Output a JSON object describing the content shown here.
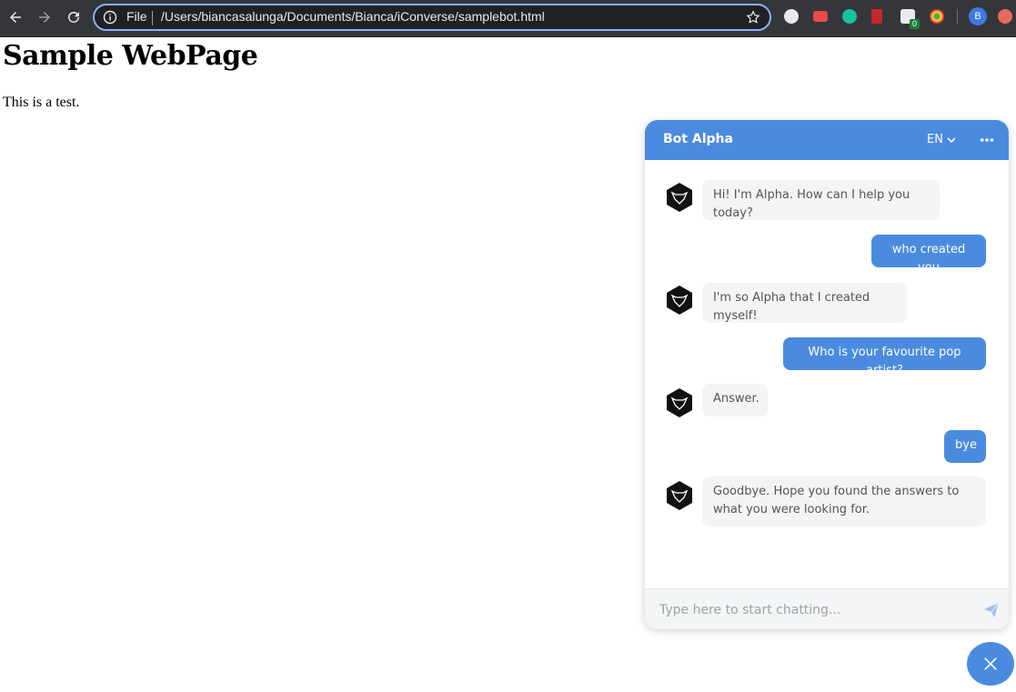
{
  "browser": {
    "omnibox": {
      "scheme_label": "File",
      "url": "/Users/biancasalunga/Documents/Bianca/iConverse/samplebot.html"
    },
    "profile_initial": "B",
    "extension_badge": "0"
  },
  "page": {
    "heading": "Sample WebPage",
    "paragraph": "This is a test."
  },
  "chat": {
    "title": "Bot Alpha",
    "language": "EN",
    "accent_color": "#4a8be0",
    "messages": [
      {
        "from": "bot",
        "text": "Hi! I'm Alpha. How can I help you today?"
      },
      {
        "from": "user",
        "text": "who created you"
      },
      {
        "from": "bot",
        "text": "I'm so Alpha that I created myself!"
      },
      {
        "from": "user",
        "text": "Who is your favourite pop artist?"
      },
      {
        "from": "bot",
        "text": "Answer."
      },
      {
        "from": "user",
        "text": "bye"
      },
      {
        "from": "bot",
        "text": "Goodbye. Hope you found the answers to what you were looking for."
      }
    ],
    "input_placeholder": "Type here to start chatting..."
  }
}
